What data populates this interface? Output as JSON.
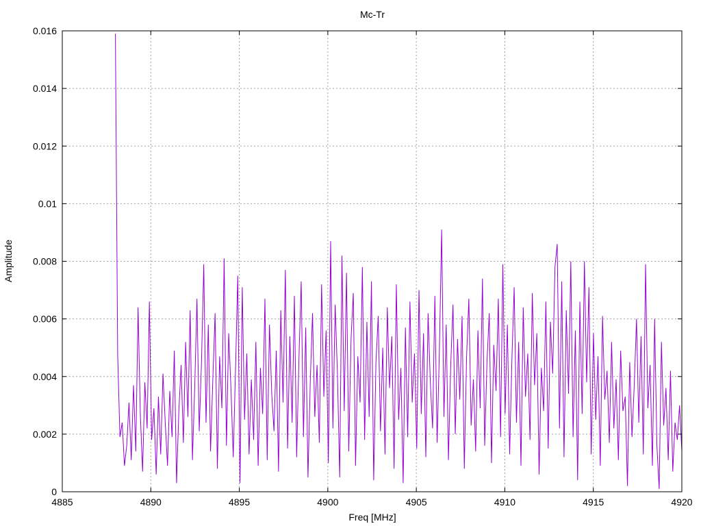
{
  "chart_data": {
    "type": "line",
    "title": "Mc-Tr",
    "xlabel": "Freq [MHz]",
    "ylabel": "Amplitude",
    "xlim": [
      4885,
      4920
    ],
    "ylim": [
      0,
      0.016
    ],
    "grid": true,
    "xticks": [
      "4885",
      "4890",
      "4895",
      "4900",
      "4905",
      "4910",
      "4915",
      "4920"
    ],
    "xtick_values": [
      4885,
      4890,
      4895,
      4900,
      4905,
      4910,
      4915,
      4920
    ],
    "yticks": [
      "0",
      "0.002",
      "0.004",
      "0.006",
      "0.008",
      "0.01",
      "0.012",
      "0.014",
      "0.016"
    ],
    "ytick_values": [
      0,
      0.002,
      0.004,
      0.006,
      0.008,
      0.01,
      0.012,
      0.014,
      0.016
    ],
    "series": [
      {
        "name": "Mc-Tr",
        "color": "#9400d3",
        "x_start": 4888.0,
        "x_step": 0.128,
        "values": [
          0.0159,
          0.0048,
          0.0019,
          0.0024,
          0.0009,
          0.0016,
          0.0031,
          0.0011,
          0.0037,
          0.0014,
          0.0064,
          0.0027,
          0.0007,
          0.0038,
          0.0022,
          0.0066,
          0.0018,
          0.0029,
          0.0006,
          0.0033,
          0.0013,
          0.0041,
          0.0024,
          0.0009,
          0.0035,
          0.0019,
          0.0049,
          0.0003,
          0.0028,
          0.0044,
          0.0017,
          0.0052,
          0.0026,
          0.0063,
          0.0011,
          0.0036,
          0.0067,
          0.0021,
          0.0045,
          0.0079,
          0.0024,
          0.0058,
          0.0014,
          0.0039,
          0.0062,
          0.0008,
          0.0047,
          0.0029,
          0.0081,
          0.0016,
          0.0055,
          0.0036,
          0.0012,
          0.0042,
          0.0075,
          0.0003,
          0.0071,
          0.0025,
          0.0048,
          0.0013,
          0.0039,
          0.0018,
          0.0052,
          0.0009,
          0.0043,
          0.0027,
          0.0067,
          0.0011,
          0.0058,
          0.0034,
          0.0021,
          0.0049,
          0.0007,
          0.0063,
          0.0031,
          0.0077,
          0.0015,
          0.0054,
          0.0024,
          0.0068,
          0.0012,
          0.0046,
          0.0073,
          0.0019,
          0.0057,
          0.0005,
          0.0038,
          0.0062,
          0.0026,
          0.0044,
          0.0017,
          0.0072,
          0.0033,
          0.0056,
          0.001,
          0.0087,
          0.0022,
          0.0065,
          0.0041,
          0.0005,
          0.0082,
          0.0028,
          0.0076,
          0.0014,
          0.0053,
          0.0069,
          0.0009,
          0.0047,
          0.0031,
          0.0078,
          0.0018,
          0.0059,
          0.0026,
          0.0073,
          0.0004,
          0.0045,
          0.0061,
          0.0021,
          0.005,
          0.0013,
          0.0064,
          0.0036,
          0.0054,
          0.0008,
          0.0072,
          0.0025,
          0.0043,
          0.0003,
          0.0057,
          0.0019,
          0.0066,
          0.0031,
          0.0048,
          0.0015,
          0.007,
          0.0027,
          0.0055,
          0.0012,
          0.0062,
          0.0038,
          0.0022,
          0.0068,
          0.0017,
          0.0049,
          0.0091,
          0.0026,
          0.0058,
          0.0011,
          0.0044,
          0.0065,
          0.002,
          0.0053,
          0.0032,
          0.0061,
          0.0008,
          0.0047,
          0.0067,
          0.0023,
          0.0039,
          0.0014,
          0.0056,
          0.0029,
          0.0074,
          0.0016,
          0.0045,
          0.0062,
          0.001,
          0.0051,
          0.0035,
          0.0067,
          0.0019,
          0.0079,
          0.0027,
          0.0058,
          0.0013,
          0.0046,
          0.0071,
          0.0024,
          0.0052,
          0.0009,
          0.0064,
          0.0033,
          0.0048,
          0.0018,
          0.0069,
          0.0037,
          0.0055,
          0.0006,
          0.0043,
          0.0028,
          0.0066,
          0.0015,
          0.0059,
          0.0041,
          0.0078,
          0.0086,
          0.0022,
          0.0073,
          0.0012,
          0.0063,
          0.0034,
          0.008,
          0.0019,
          0.0056,
          0.0004,
          0.0066,
          0.0027,
          0.008,
          0.0038,
          0.0071,
          0.0013,
          0.0055,
          0.0025,
          0.0047,
          0.0009,
          0.0061,
          0.0032,
          0.0042,
          0.0017,
          0.0052,
          0.0022,
          0.0039,
          0.0011,
          0.0049,
          0.0028,
          0.0033,
          0.0002,
          0.0045,
          0.0019,
          0.0037,
          0.006,
          0.0024,
          0.0054,
          0.0013,
          0.0079,
          0.0029,
          0.0044,
          0.0009,
          0.006,
          0.0016,
          0.0001,
          0.0052,
          0.0023,
          0.0036,
          0.0011,
          0.0042,
          0.0007,
          0.0024,
          0.0018,
          0.003,
          0.0014
        ]
      }
    ]
  }
}
